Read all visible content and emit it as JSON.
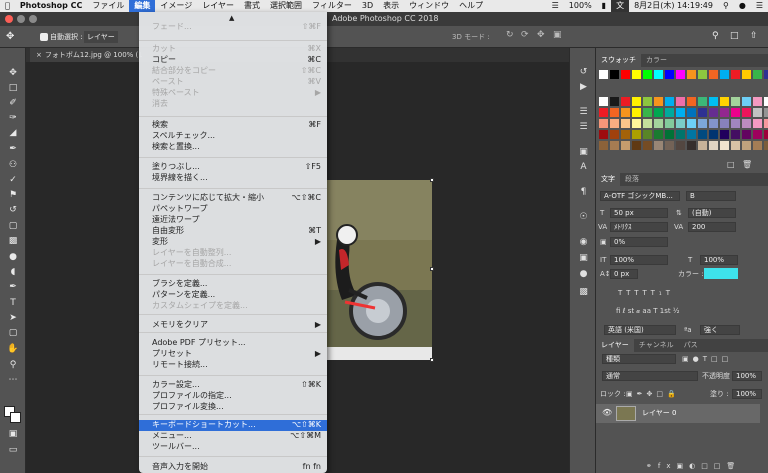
{
  "menubar": {
    "app": "Photoshop CC",
    "items": [
      "ファイル",
      "編集",
      "イメージ",
      "レイヤー",
      "書式",
      "選択範囲",
      "フィルター",
      "3D",
      "表示",
      "ウィンドウ",
      "ヘルプ"
    ],
    "battery": "100%",
    "datetime": "8月2日(木)  14:19:49"
  },
  "window_title": "Adobe Photoshop CC 2018",
  "options": {
    "auto_select_label": "自動選択 :",
    "auto_select_value": "レイヤー",
    "mode_3d": "3D モード :"
  },
  "document_tab": "フォトボム12.jpg @ 100% (レイ",
  "edit_menu": {
    "items": [
      {
        "label": "フェード...",
        "shortcut": "⇧⌘F",
        "disabled": true
      },
      {
        "label": "カット",
        "shortcut": "⌘X",
        "disabled": true
      },
      {
        "label": "コピー",
        "shortcut": "⌘C",
        "disabled": false
      },
      {
        "label": "結合部分をコピー",
        "shortcut": "⇧⌘C",
        "disabled": true
      },
      {
        "label": "ペースト",
        "shortcut": "⌘V",
        "disabled": true
      },
      {
        "label": "特殊ペースト",
        "shortcut": "▶",
        "disabled": true
      },
      {
        "label": "消去",
        "shortcut": "",
        "disabled": true
      },
      {
        "label": "検索",
        "shortcut": "⌘F",
        "disabled": false
      },
      {
        "label": "スペルチェック...",
        "shortcut": "",
        "disabled": false
      },
      {
        "label": "検索と置換...",
        "shortcut": "",
        "disabled": false
      },
      {
        "label": "塗りつぶし...",
        "shortcut": "⇧F5",
        "disabled": false
      },
      {
        "label": "境界線を描く...",
        "shortcut": "",
        "disabled": false
      },
      {
        "label": "コンテンツに応じて拡大・縮小",
        "shortcut": "⌥⇧⌘C",
        "disabled": false
      },
      {
        "label": "パペットワープ",
        "shortcut": "",
        "disabled": false
      },
      {
        "label": "遠近法ワープ",
        "shortcut": "",
        "disabled": false
      },
      {
        "label": "自由変形",
        "shortcut": "⌘T",
        "disabled": false
      },
      {
        "label": "変形",
        "shortcut": "▶",
        "disabled": false
      },
      {
        "label": "レイヤーを自動整列...",
        "shortcut": "",
        "disabled": true
      },
      {
        "label": "レイヤーを自動合成...",
        "shortcut": "",
        "disabled": true
      },
      {
        "label": "ブラシを定義...",
        "shortcut": "",
        "disabled": false
      },
      {
        "label": "パターンを定義...",
        "shortcut": "",
        "disabled": false
      },
      {
        "label": "カスタムシェイプを定義...",
        "shortcut": "",
        "disabled": true
      },
      {
        "label": "メモリをクリア",
        "shortcut": "▶",
        "disabled": false
      },
      {
        "label": "Adobe PDF プリセット...",
        "shortcut": "",
        "disabled": false
      },
      {
        "label": "プリセット",
        "shortcut": "▶",
        "disabled": false
      },
      {
        "label": "リモート接続...",
        "shortcut": "",
        "disabled": false
      },
      {
        "label": "カラー設定...",
        "shortcut": "⇧⌘K",
        "disabled": false
      },
      {
        "label": "プロファイルの指定...",
        "shortcut": "",
        "disabled": false
      },
      {
        "label": "プロファイル変換...",
        "shortcut": "",
        "disabled": false
      },
      {
        "label": "キーボードショートカット...",
        "shortcut": "⌥⇧⌘K",
        "disabled": false,
        "highlighted": true
      },
      {
        "label": "メニュー...",
        "shortcut": "⌥⇧⌘M",
        "disabled": false
      },
      {
        "label": "ツールバー...",
        "shortcut": "",
        "disabled": false
      },
      {
        "label": "音声入力を開始",
        "shortcut": "fn fn",
        "disabled": false
      }
    ]
  },
  "swatches_panel": {
    "tabs": [
      "スウォッチ",
      "カラー"
    ],
    "colors": [
      "#ffffff",
      "#000000",
      "#ff0000",
      "#ffff00",
      "#00ff00",
      "#00ffff",
      "#0000ff",
      "#ff00ff"
    ]
  },
  "character_panel": {
    "tabs": [
      "文字",
      "段落"
    ],
    "font_family": "A-OTF ゴシックMB...",
    "font_style": "B",
    "size": "50 px",
    "leading": "(自動)",
    "kerning": "ﾒﾄﾘｸｽ",
    "tracking": "200",
    "tsume": "0%",
    "vscale": "100%",
    "hscale": "100%",
    "baseline": "0 px",
    "color_label": "カラー :",
    "text_color": "#3ee3ec",
    "language": "英語 (米国)",
    "aa": "強く"
  },
  "layers_panel": {
    "tabs": [
      "レイヤー",
      "チャンネル",
      "パス"
    ],
    "filter": "種類",
    "blend_mode": "通常",
    "opacity_label": "不透明度 :",
    "opacity": "100%",
    "lock_label": "ロック :",
    "fill_label": "塗り :",
    "fill": "100%",
    "layer_name": "レイヤー 0"
  }
}
